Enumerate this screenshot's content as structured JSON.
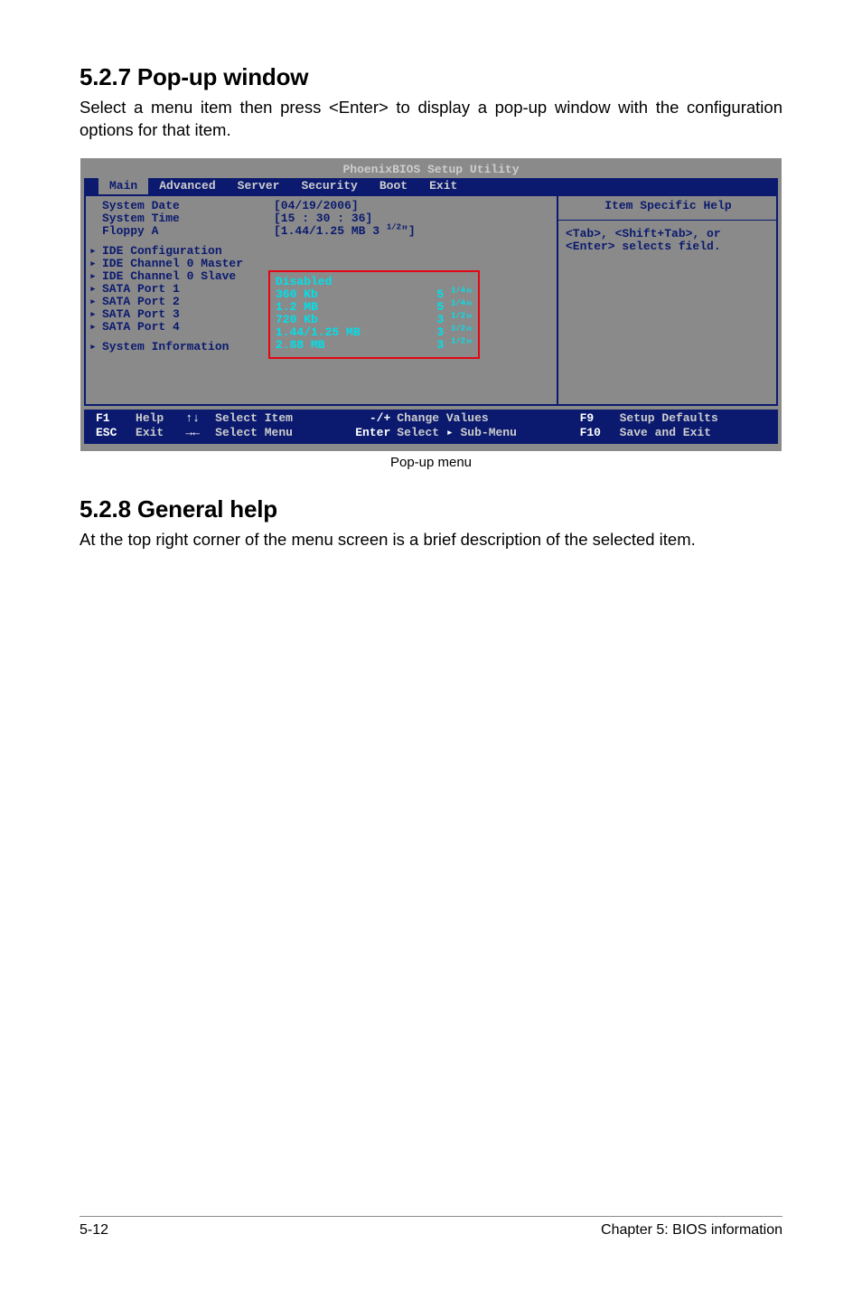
{
  "doc": {
    "section1_title": "5.2.7 Pop-up window",
    "section1_body": "Select a menu item then press <Enter> to display a pop-up window with the configuration options for that item.",
    "popup_caption": "Pop-up menu",
    "section2_title": "5.2.8  General help",
    "section2_body": "At the top right corner of the menu screen is a brief description of the selected item.",
    "footer_left": "5-12",
    "footer_right": "Chapter 5: BIOS information"
  },
  "bios": {
    "utility_title": "PhoenixBIOS Setup Utility",
    "tabs": [
      "Main",
      "Advanced",
      "Server",
      "Security",
      "Boot",
      "Exit"
    ],
    "active_tab_index": 0,
    "fields": {
      "system_date": {
        "label": "System Date",
        "value": "[04/19/2006]"
      },
      "system_time": {
        "label": "System Time",
        "value": "[15 : 30 : 36]"
      },
      "floppy_a_label": "Floppy A",
      "floppy_a_value_pre": "[1.44/1.25 MB 3 ",
      "floppy_a_value_sup": "1/2",
      "floppy_a_value_post": "\"]"
    },
    "submenus": [
      "IDE Configuration",
      "IDE Channel 0 Master",
      "IDE Channel 0 Slave",
      "SATA Port 1",
      "SATA Port 2",
      "SATA Port 3",
      "SATA Port 4"
    ],
    "sysinfo_label": "System Information",
    "popup": {
      "options": [
        {
          "name": "Disabled",
          "size_num": "",
          "size_frac": "",
          "size_unit": ""
        },
        {
          "name": "360 Kb",
          "size_num": "5",
          "size_frac": "1/4",
          "size_unit": "\""
        },
        {
          "name": "1.2 MB",
          "size_num": "5",
          "size_frac": "1/4",
          "size_unit": "\""
        },
        {
          "name": "720 Kb",
          "size_num": "3",
          "size_frac": "1/2",
          "size_unit": "\""
        },
        {
          "name": "1.44/1.25 MB",
          "size_num": "3",
          "size_frac": "1/2",
          "size_unit": "\""
        },
        {
          "name": "2.88 MB",
          "size_num": "3",
          "size_frac": "1/2",
          "size_unit": "\""
        }
      ]
    },
    "help": {
      "title": "Item Specific Help",
      "text": "<Tab>, <Shift+Tab>, or <Enter> selects field."
    },
    "footer": {
      "f1_key": "F1",
      "f1_label": "Help",
      "esc_key": "ESC",
      "esc_label": "Exit",
      "updn_sym": "↑↓",
      "updn_label": "Select Item",
      "lr_sym": "→←",
      "lr_label": "Select Menu",
      "chg_key": "-/+",
      "chg_label": "Change Values",
      "enter_key": "Enter",
      "enter_label_pre": "Select ",
      "enter_label_post": " Sub-Menu",
      "f9_key": "F9",
      "f9_label": "Setup Defaults",
      "f10_key": "F10",
      "f10_label": "Save and Exit"
    }
  }
}
